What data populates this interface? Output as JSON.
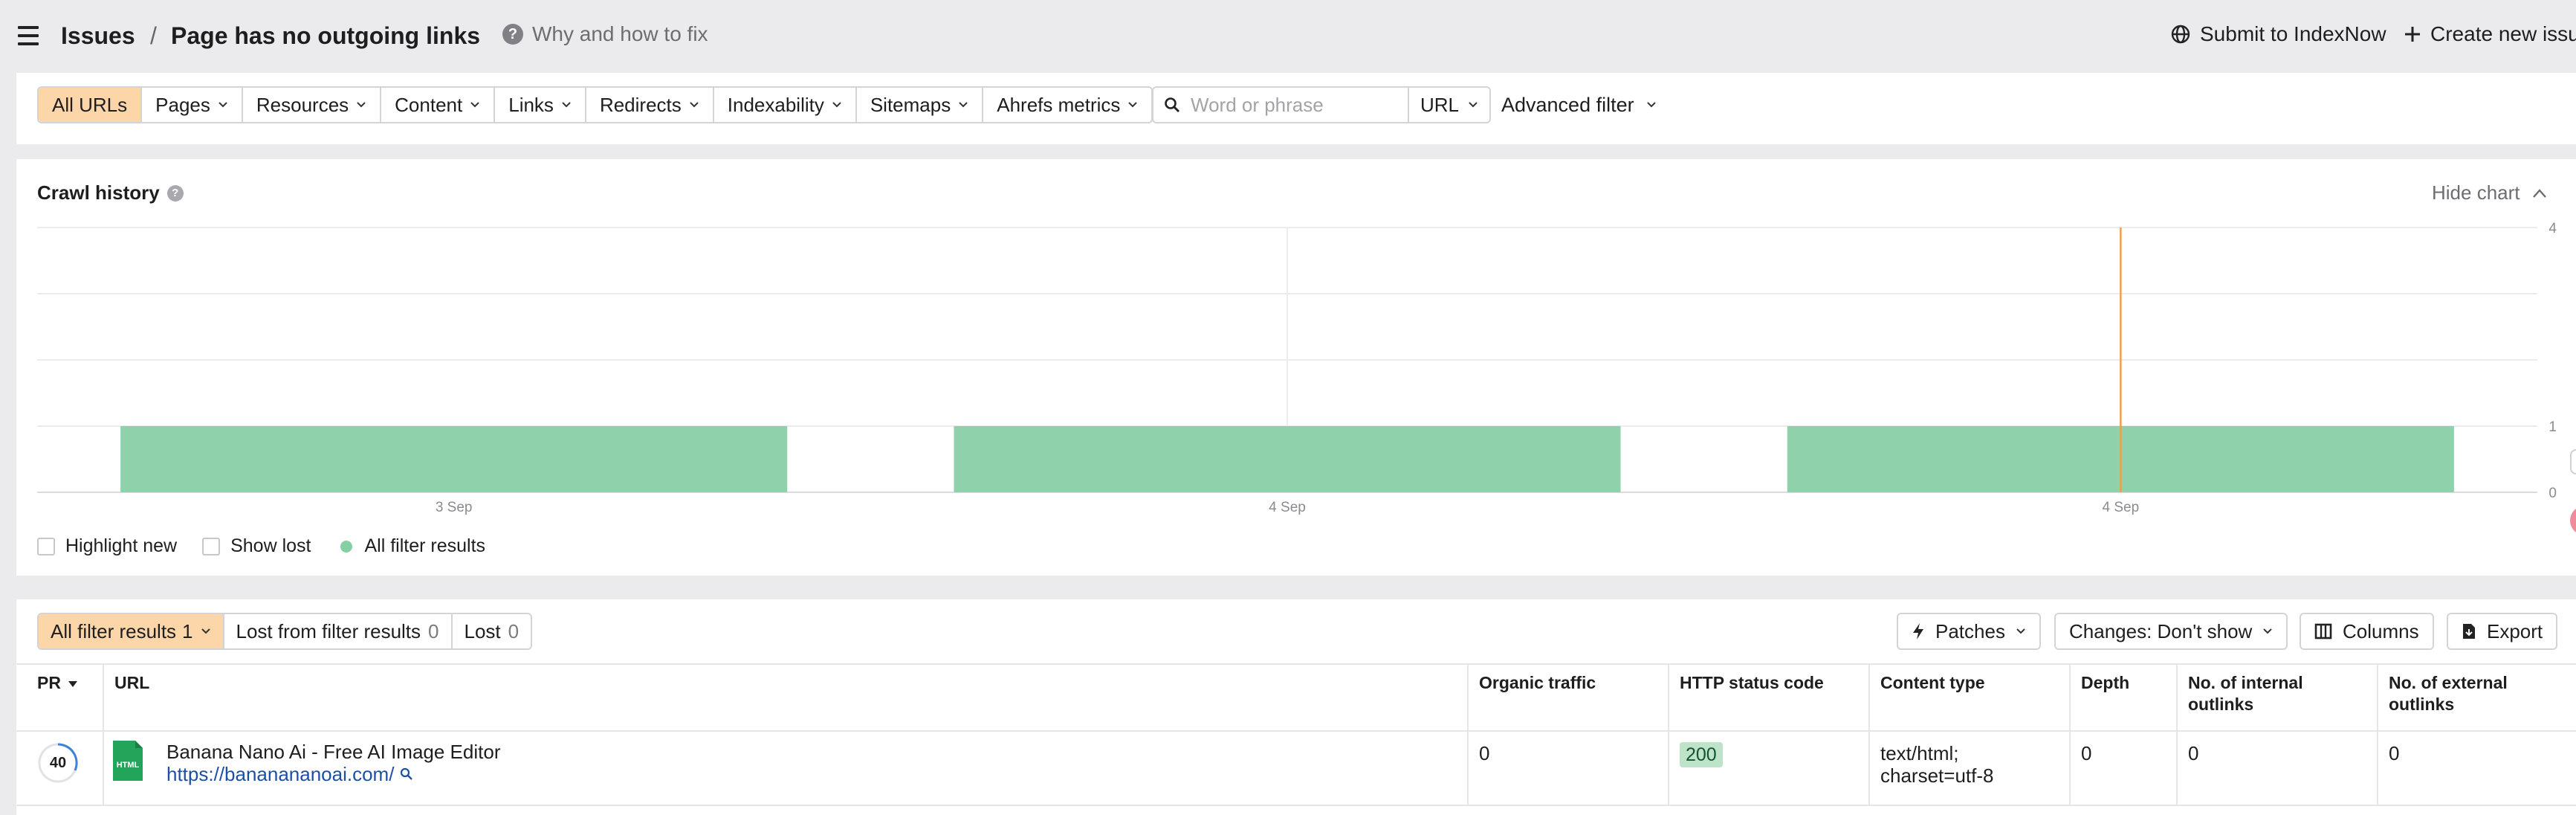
{
  "header": {
    "crumb_root": "Issues",
    "crumb_sep": "/",
    "page_title": "Page has no outgoing links",
    "help_link": "Why and how to fix",
    "submit_btn": "Submit to IndexNow",
    "create_btn": "Create new issue"
  },
  "filters": {
    "segments": [
      "All URLs",
      "Pages",
      "Resources",
      "Content",
      "Links",
      "Redirects",
      "Indexability",
      "Sitemaps",
      "Ahrefs metrics"
    ],
    "search_placeholder": "Word or phrase",
    "search_scope": "URL",
    "advanced": "Advanced filter"
  },
  "crawl_history": {
    "title": "Crawl history",
    "hide_chart": "Hide chart",
    "legend": {
      "highlight_new": "Highlight new",
      "show_lost": "Show lost",
      "all_results": "All filter results"
    }
  },
  "chart_data": {
    "type": "bar",
    "categories": [
      "3 Sep",
      "4 Sep",
      "4 Sep"
    ],
    "values": [
      1,
      1,
      1
    ],
    "y_ticks": [
      "0",
      "1",
      "4"
    ],
    "ylim": [
      0,
      4
    ],
    "grid": true,
    "bar_color": "#8ed1ab",
    "marker_color": "#f0a04b",
    "marker_index": 2
  },
  "results": {
    "tabs": [
      {
        "label": "All filter results",
        "count": "1"
      },
      {
        "label": "Lost from filter results",
        "count": "0"
      },
      {
        "label": "Lost",
        "count": "0"
      }
    ],
    "toolbar": {
      "patches": "Patches",
      "changes": "Changes: Don't show",
      "columns": "Columns",
      "export": "Export"
    },
    "columns": {
      "pr": "PR",
      "url": "URL",
      "organic": "Organic traffic",
      "status": "HTTP status code",
      "content_type": "Content type",
      "depth": "Depth",
      "internal": "No. of internal outlinks",
      "external": "No. of external outlinks"
    },
    "rows": [
      {
        "pr": "40",
        "title": "Banana Nano Ai - Free AI Image Editor",
        "url": "https://bananananoai.com/",
        "organic": "0",
        "status": "200",
        "content_type": "text/html; charset=utf-8",
        "depth": "0",
        "internal": "0",
        "external": "0"
      }
    ]
  },
  "colors": {
    "active_segment": "#fcd5a9",
    "accent_marker": "#f0a04b",
    "status_ok": "#bde3c9"
  }
}
